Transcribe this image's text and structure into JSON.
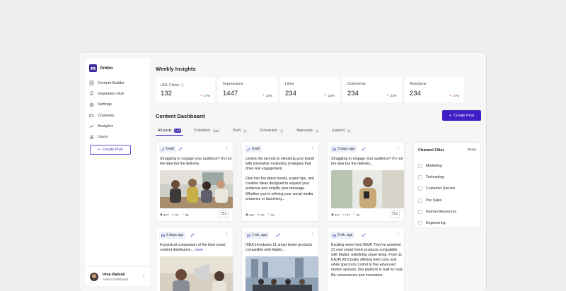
{
  "app": {
    "name": "Ambo",
    "logo_letter": "m"
  },
  "nav": [
    {
      "label": "Content Builder",
      "icon": "content-icon"
    },
    {
      "label": "Inspiration Hub",
      "icon": "bulb-icon"
    },
    {
      "label": "Settings",
      "icon": "gear-icon"
    },
    {
      "label": "Channels",
      "icon": "channels-icon"
    },
    {
      "label": "Analytics",
      "icon": "chart-icon"
    },
    {
      "label": "Users",
      "icon": "user-icon"
    }
  ],
  "sidebar": {
    "create_label": "Create Post"
  },
  "user": {
    "name": "Irfan Rafeek",
    "role": "Admin Dashboard"
  },
  "insights": {
    "title": "Weekly Insights",
    "kpis": [
      {
        "label": "URL Clicks",
        "value": "132",
        "delta": "17%",
        "trend": "down"
      },
      {
        "label": "Impressions",
        "value": "1447",
        "delta": "23%",
        "trend": "up"
      },
      {
        "label": "Likes",
        "value": "234",
        "delta": "23%",
        "trend": "up"
      },
      {
        "label": "Comments",
        "value": "234",
        "delta": "23%",
        "trend": "up"
      },
      {
        "label": "Reactions",
        "value": "234",
        "delta": "17%",
        "trend": "down"
      }
    ]
  },
  "dashboard": {
    "title": "Content Dashboard",
    "create_label": "Create Post",
    "tabs": [
      {
        "label": "All posts",
        "count": "143"
      },
      {
        "label": "Published",
        "count": "142"
      },
      {
        "label": "Draft",
        "count": "2"
      },
      {
        "label": "Scheduled",
        "count": "8"
      },
      {
        "label": "Approvals",
        "count": "0"
      },
      {
        "label": "Expired",
        "count": "8"
      }
    ]
  },
  "cards": [
    {
      "chip": "Draft",
      "text": "Struggling to engage your audience? It's not the idea but the delivery...",
      "views": "427",
      "comments": "27",
      "likes": "34",
      "count": "3"
    },
    {
      "chip": "Draft",
      "text": "Unlock the secrets to elevating your brand with innovative marketing strategies that drive real engagement.",
      "text2": "Dive into the latest trends, expert tips, and creative ideas designed to expand your audience and amplify your message. Whether you're refining your social media presence or launching...",
      "views": "427",
      "comments": "27",
      "likes": "34"
    },
    {
      "chip": "3 days ago",
      "text": "Struggling to engage your audience? It's not the idea but the delivery...",
      "views": "427",
      "comments": "27",
      "likes": "34",
      "count": "2"
    },
    {
      "chip": "2 days ago",
      "text": "A practical comparison of the best social content distribution...",
      "more": "more"
    },
    {
      "chip": "1 wk. ago",
      "text": "IKEA introduces 21 smart home products compatible with Matter..."
    },
    {
      "chip": "2 wk. ago",
      "text": "Exciting news from IKEA! They've unveiled 21 new smart home products compatible with Matter, redefining smart living. From 11 KAJPLATS bulbs offering both color and white spectrum control to five advanced motion sensors, this platform is built for real-life convenience and innovation."
    }
  ],
  "filter": {
    "title": "Channel Filter",
    "reset": "Reset",
    "items": [
      "Marketing",
      "Technology",
      "Customer Service",
      "Pre Sales",
      "Human Resources",
      "Engineering"
    ]
  },
  "colors": {
    "accent": "#3f1fc6",
    "up": "#1e9e5a",
    "down": "#d23b3b"
  }
}
